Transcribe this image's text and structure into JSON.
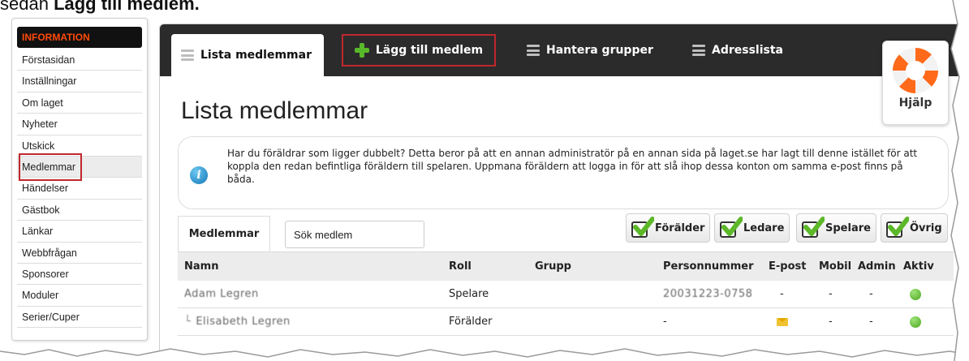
{
  "caption": {
    "text": "sedan ",
    "bold": "Lägg till medlem."
  },
  "sidebar": {
    "header": "INFORMATION",
    "items": [
      {
        "label": "Förstasidan"
      },
      {
        "label": "Inställningar"
      },
      {
        "label": "Om laget"
      },
      {
        "label": "Nyheter"
      },
      {
        "label": "Utskick"
      },
      {
        "label": "Medlemmar"
      },
      {
        "label": "Händelser"
      },
      {
        "label": "Gästbok"
      },
      {
        "label": "Länkar"
      },
      {
        "label": "Webbfrågan"
      },
      {
        "label": "Sponsorer"
      },
      {
        "label": "Moduler"
      },
      {
        "label": "Serier/Cuper"
      }
    ]
  },
  "tabs": {
    "list": "Lista medlemmar",
    "add": "Lägg till medlem",
    "groups": "Hantera grupper",
    "address": "Adresslista"
  },
  "help": {
    "label": "Hjälp"
  },
  "page": {
    "title": "Lista medlemmar"
  },
  "info": {
    "text": "Har du föräldrar som ligger dubbelt? Detta beror på att en annan administratör på en annan sida på laget.se har lagt till denne istället för att koppla den redan befintliga föräldern till spelaren. Uppmana föräldern att logga in för att slå ihop dessa konton om samma e-post finns på båda."
  },
  "members_tab": {
    "label": "Medlemmar"
  },
  "search": {
    "value": "Sök medlem"
  },
  "filters": {
    "parent": "Förälder",
    "leader": "Ledare",
    "player": "Spelare",
    "other": "Övrig"
  },
  "table": {
    "headers": {
      "name": "Namn",
      "role": "Roll",
      "group": "Grupp",
      "ssn": "Personnummer",
      "email": "E-post",
      "mobile": "Mobil",
      "admin": "Admin",
      "active": "Aktiv"
    },
    "rows": [
      {
        "name": "Adam Legren",
        "role": "Spelare",
        "group": "",
        "ssn": "20031223-0758",
        "email": "-",
        "mobile": "-",
        "admin": "-"
      },
      {
        "name": "Elisabeth Legren",
        "role": "Förälder",
        "group": "",
        "ssn": "-",
        "email": "",
        "mobile": "-",
        "admin": "-"
      }
    ]
  },
  "colors": {
    "accent_red": "#c0272d",
    "sidebar_header_text": "#ff4a0a",
    "tabbar": "#2b2b2b",
    "plus_green": "#59b82a",
    "check_green": "#5db829"
  },
  "icons": [
    "list-icon",
    "plus-icon",
    "list-icon",
    "list-icon",
    "lifebuoy-icon",
    "info-icon",
    "checkbox-icon",
    "envelope-icon",
    "status-dot-icon"
  ]
}
